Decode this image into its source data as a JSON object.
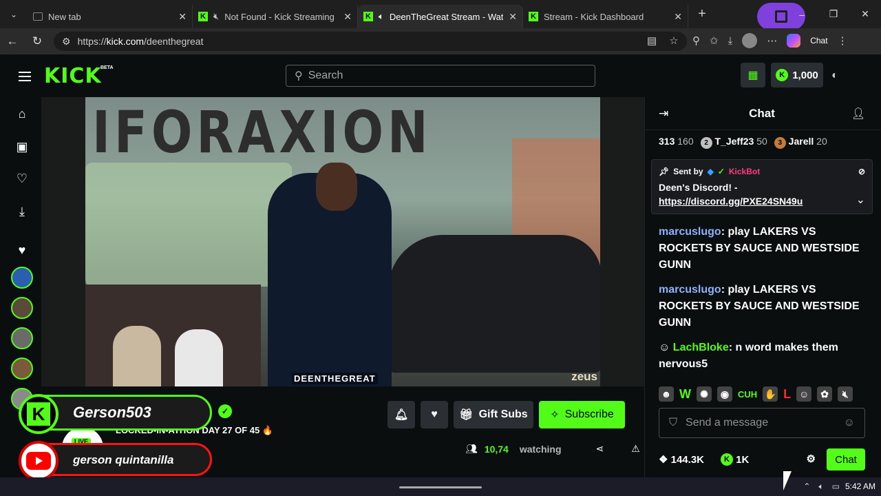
{
  "browser": {
    "tabs": [
      {
        "title": "New tab"
      },
      {
        "title": "Not Found - Kick Streaming"
      },
      {
        "title": "DeenTheGreat Stream - Watch"
      },
      {
        "title": "Stream - Kick Dashboard"
      }
    ],
    "url_prefix": "https://",
    "url_host": "kick.com",
    "url_path": "/deenthegreat",
    "chat_label": "Chat"
  },
  "header": {
    "logo": "KICK",
    "beta": "BETA",
    "search_placeholder": "Search",
    "wallet": "1,000"
  },
  "stream": {
    "video_watermark": "DEENTHEGREAT",
    "wall_text": "IFORAXION",
    "sponsor": "zeus",
    "title": "LOCKED-IN-ATHON DAY 27 OF 45 🔥",
    "live": "LIVE",
    "viewers": "10,74",
    "watching": "watching",
    "gift_subs": "Gift Subs",
    "subscribe": "Subscribe"
  },
  "overlay": {
    "kick_name": "Gerson503",
    "youtube_name": "gerson quintanilla"
  },
  "chat": {
    "title": "Chat",
    "leaderboard": [
      {
        "rank": "",
        "name": "313",
        "count": "160"
      },
      {
        "rank": "2",
        "name": "T_Jeff23",
        "count": "50"
      },
      {
        "rank": "3",
        "name": "Jarell",
        "count": "20"
      }
    ],
    "pinned": {
      "sent_by": "Sent by",
      "bot": "KickBot",
      "message": "Deen's Discord! -",
      "link": "https://discord.gg/PXE24SN49u"
    },
    "messages": [
      {
        "user": "marcuslugo",
        "text": " play LAKERS VS ROCKETS BY SAUCE AND WESTSIDE GUNN"
      },
      {
        "user": "marcuslugo",
        "text": " play LAKERS VS ROCKETS BY SAUCE AND WESTSIDE GUNN"
      },
      {
        "user": "LachBloke",
        "text": " n word makes them nervous5"
      }
    ],
    "emotes": [
      "W",
      "CUH",
      "L"
    ],
    "input_placeholder": "Send a message",
    "followers": "144.3K",
    "kicks": "1K",
    "chat_button": "Chat"
  },
  "taskbar": {
    "time": "5:42 AM"
  },
  "colors": {
    "kick_green": "#53fc18",
    "background": "#0b0e0f"
  }
}
